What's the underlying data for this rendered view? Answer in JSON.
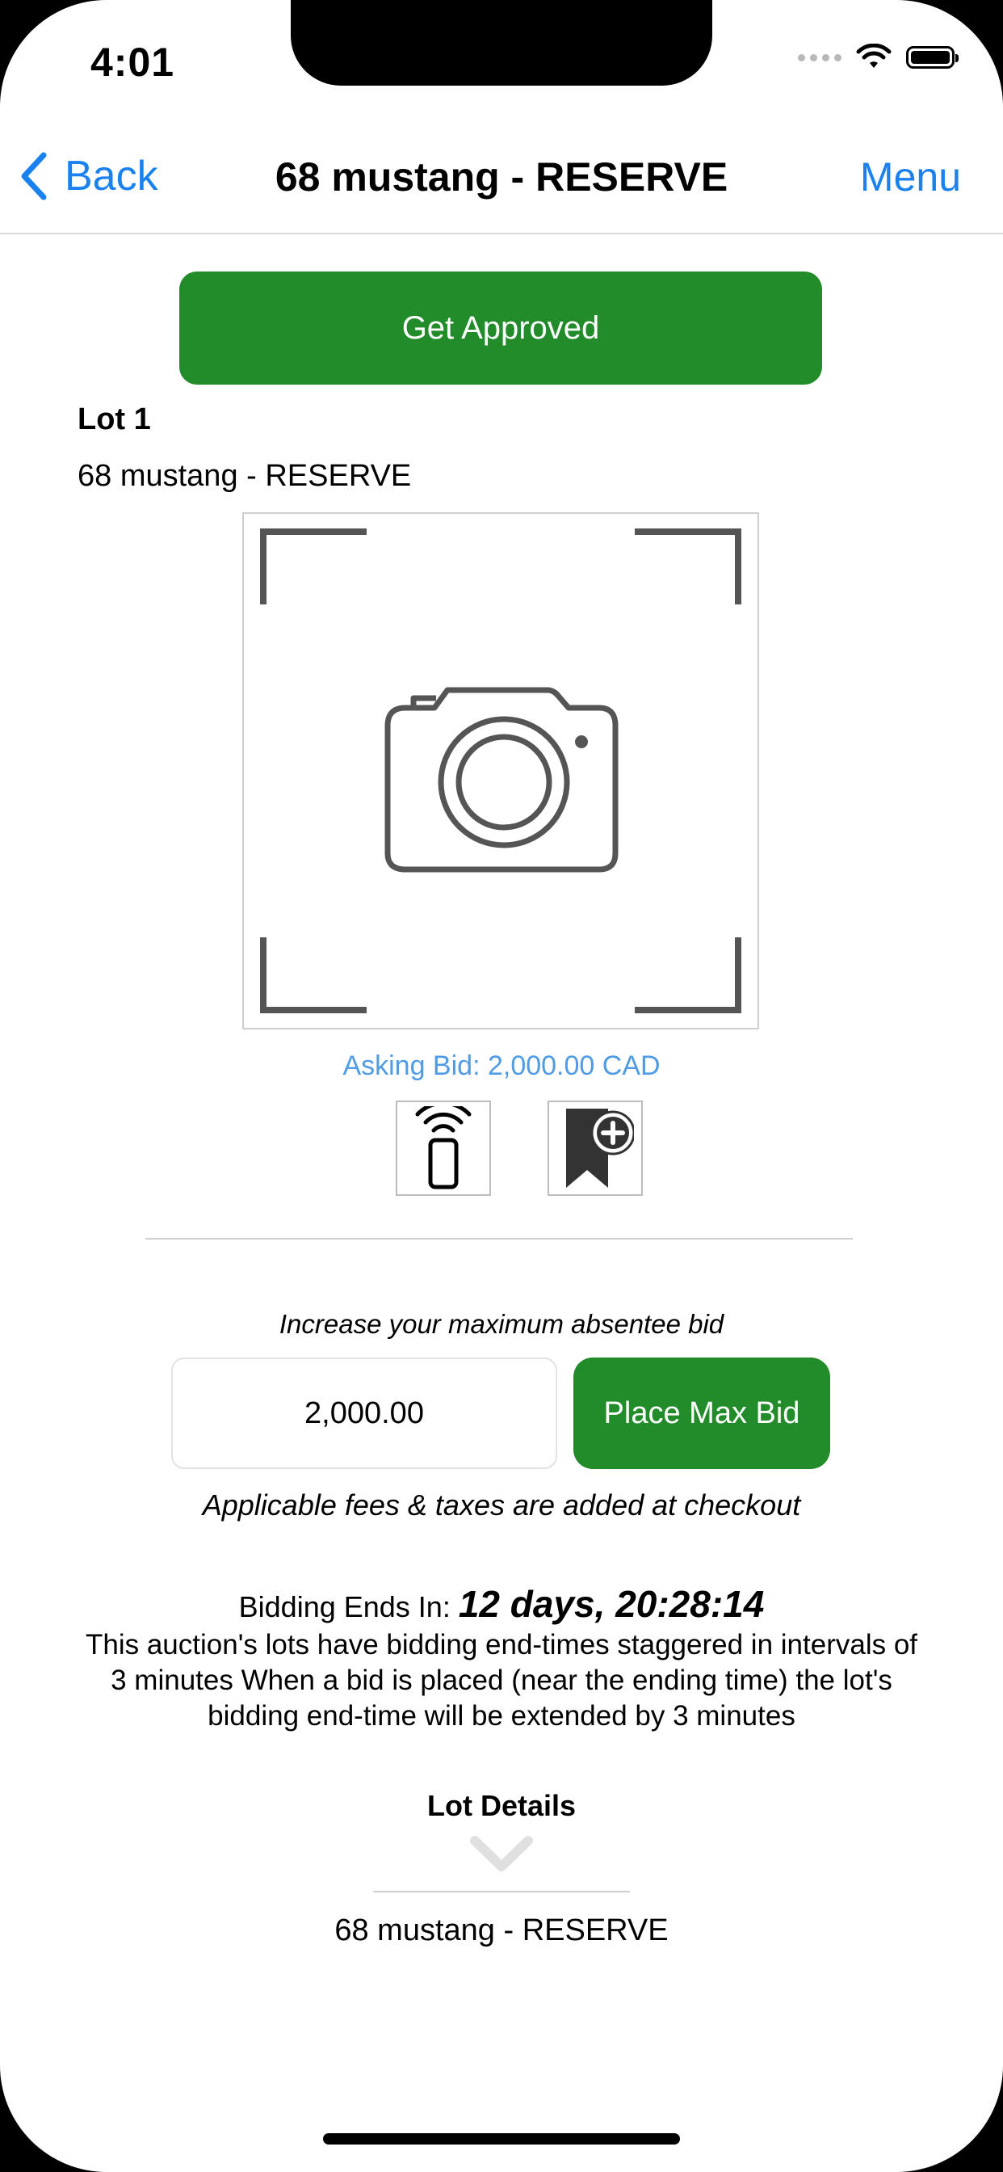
{
  "status_bar": {
    "time": "4:01"
  },
  "nav": {
    "back_label": "Back",
    "title": "68 mustang - RESERVE",
    "menu_label": "Menu"
  },
  "actions": {
    "get_approved_label": "Get Approved"
  },
  "lot": {
    "label": "Lot 1",
    "name": "68 mustang - RESERVE",
    "asking_bid": "Asking Bid: 2,000.00 CAD"
  },
  "bid": {
    "prompt": "Increase your maximum absentee bid",
    "input_value": "2,000.00",
    "place_label": "Place Max Bid",
    "fees_note": "Applicable fees & taxes are added at checkout"
  },
  "ending": {
    "label": "Bidding Ends In:",
    "countdown": "12 days, 20:28:14",
    "description": "This auction's lots have bidding end-times staggered in intervals of 3 minutes When a bid is placed (near the ending time) the lot's bidding end-time will be extended by 3 minutes"
  },
  "details": {
    "heading": "Lot Details",
    "text": "68 mustang - RESERVE"
  },
  "colors": {
    "accent_blue": "#1a82f0",
    "button_green": "#238c2a",
    "asking_blue": "#4f9be6"
  },
  "icons": [
    "chevron-left-icon",
    "wifi-icon",
    "battery-icon",
    "camera-placeholder-icon",
    "remote-bid-icon",
    "bookmark-add-icon",
    "chevron-down-icon"
  ]
}
